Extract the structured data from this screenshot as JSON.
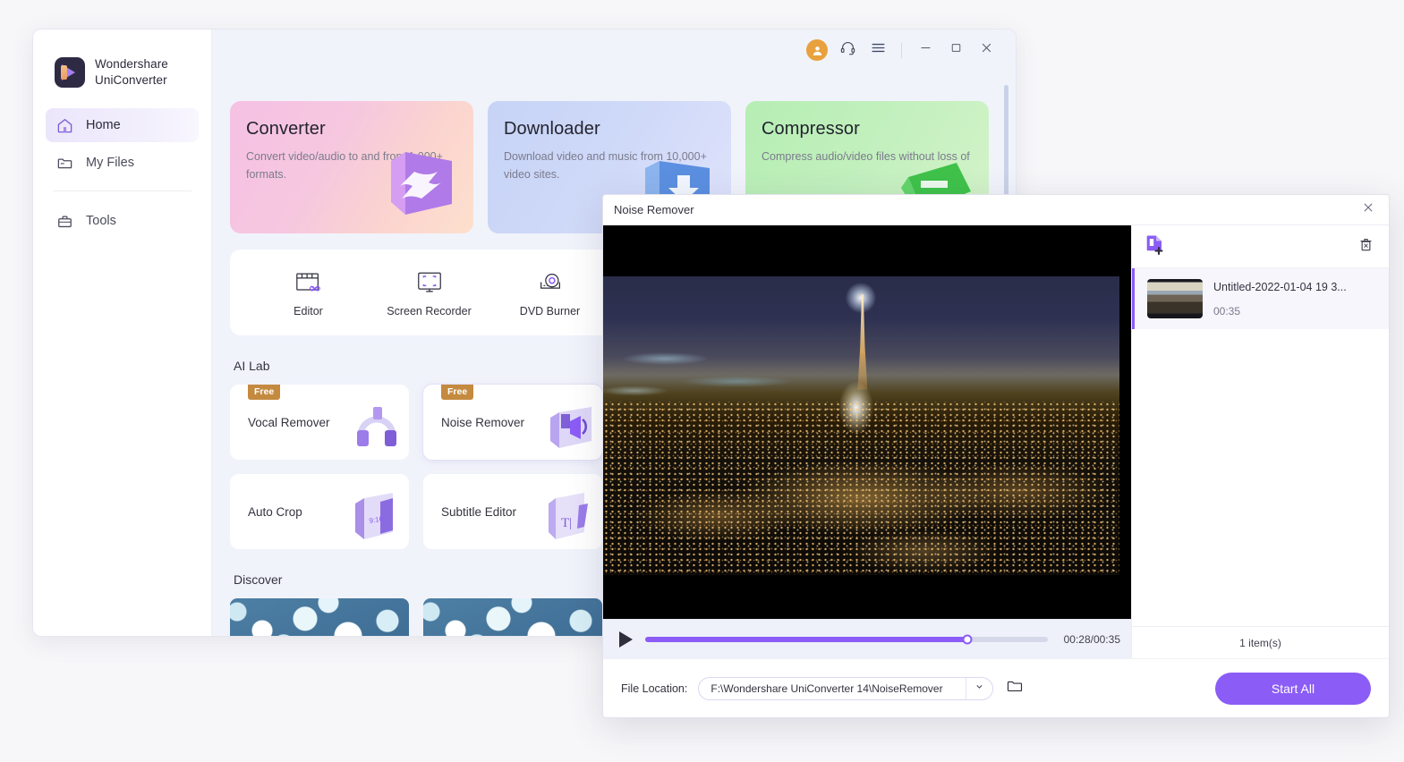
{
  "app": {
    "brand_line1": "Wondershare",
    "brand_line2": "UniConverter",
    "sidebar": [
      {
        "label": "Home",
        "icon": "home-icon"
      },
      {
        "label": "My Files",
        "icon": "folder-icon"
      },
      {
        "label": "Tools",
        "icon": "toolbox-icon"
      }
    ],
    "titlebar": {
      "avatar": "user-avatar-icon",
      "support": "headset-icon",
      "menu": "hamburger-menu-icon",
      "minimize": "minimize-icon",
      "maximize": "maximize-icon",
      "close": "close-icon"
    },
    "cards": [
      {
        "title": "Converter",
        "desc": "Convert video/audio to and from 1,000+ formats.",
        "accent": "#f5c1e4"
      },
      {
        "title": "Downloader",
        "desc": "Download video and music from 10,000+ video sites.",
        "accent": "#c7d4f6"
      },
      {
        "title": "Compressor",
        "desc": "Compress audio/video files without loss of",
        "accent": "#b6eeb4"
      }
    ],
    "tools": [
      {
        "label": "Editor",
        "icon": "editor-icon"
      },
      {
        "label": "Screen Recorder",
        "icon": "screen-recorder-icon"
      },
      {
        "label": "DVD Burner",
        "icon": "dvd-burner-icon"
      }
    ],
    "ai_lab_title": "AI Lab",
    "ai_lab": [
      {
        "label": "Vocal Remover",
        "badge": "Free",
        "icon": "headphones-art"
      },
      {
        "label": "Noise Remover",
        "badge": "Free",
        "icon": "noise-art"
      },
      {
        "label": "Auto Crop",
        "badge": "",
        "icon": "crop-art"
      },
      {
        "label": "Subtitle Editor",
        "badge": "",
        "icon": "subtitle-art"
      }
    ],
    "discover_title": "Discover"
  },
  "dialog": {
    "title": "Noise Remover",
    "close": "close-icon",
    "player": {
      "play_icon": "play-icon",
      "progress_percent": 80,
      "time": "00:28/00:35"
    },
    "file_panel": {
      "add_icon": "add-file-icon",
      "delete_icon": "delete-icon",
      "items": [
        {
          "name": "Untitled-2022-01-04 19 3...",
          "duration": "00:35"
        }
      ],
      "count_label": "1 item(s)"
    },
    "footer": {
      "location_label": "File Location:",
      "location_value": "F:\\Wondershare UniConverter 14\\NoiseRemover",
      "caret_icon": "chevron-down-icon",
      "folder_icon": "folder-open-icon",
      "start_label": "Start All"
    }
  },
  "colors": {
    "accent_purple": "#8b5cf6",
    "badge_orange": "#c48a3f",
    "avatar_orange": "#e8a13c"
  }
}
